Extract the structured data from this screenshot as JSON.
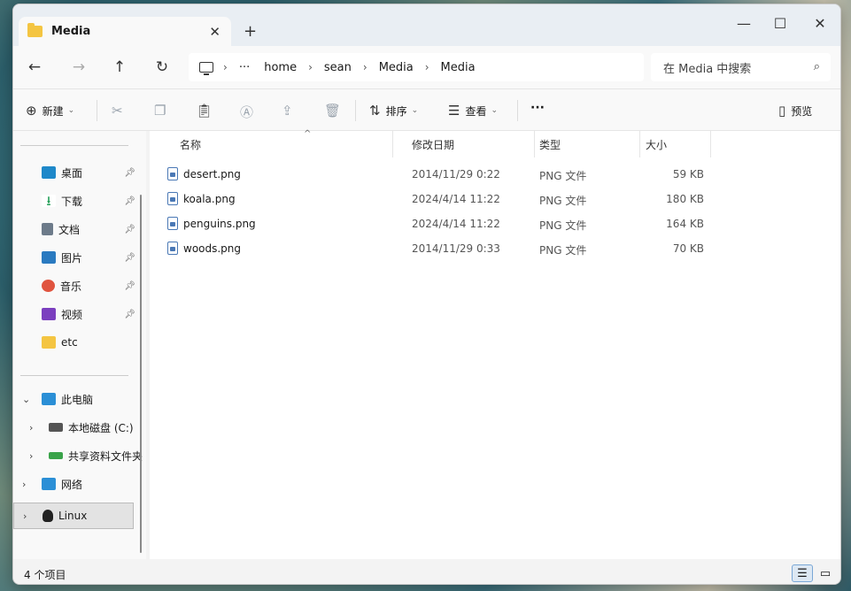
{
  "window": {
    "tab_title": "Media",
    "tab_close": "✕",
    "new_tab": "+",
    "minimize": "—",
    "maximize": "☐",
    "close": "✕"
  },
  "nav": {
    "back": "←",
    "forward": "→",
    "up": "↑",
    "refresh": "↻",
    "more": "···",
    "breadcrumb": [
      "home",
      "sean",
      "Media",
      "Media"
    ],
    "search_placeholder": "在 Media 中搜索"
  },
  "toolbar": {
    "new_label": "新建",
    "sort_label": "排序",
    "view_label": "查看",
    "more": "···",
    "preview_label": "预览"
  },
  "sidebar": {
    "quick_access": [
      {
        "label": "桌面",
        "icon": "desktop-icon",
        "color": "#1e88c9",
        "pinned": true
      },
      {
        "label": "下载",
        "icon": "download-icon",
        "color": "#1f9d55",
        "pinned": true
      },
      {
        "label": "文档",
        "icon": "documents-icon",
        "color": "#6d7b8a",
        "pinned": true
      },
      {
        "label": "图片",
        "icon": "pictures-icon",
        "color": "#2a7ac0",
        "pinned": true
      },
      {
        "label": "音乐",
        "icon": "music-icon",
        "color": "#e0543f",
        "pinned": true
      },
      {
        "label": "视频",
        "icon": "videos-icon",
        "color": "#7b3fbf",
        "pinned": true
      },
      {
        "label": "etc",
        "icon": "folder-icon",
        "color": "#f4c542",
        "pinned": false
      }
    ],
    "this_pc": "此电脑",
    "local_disk": "本地磁盘 (C:)",
    "shared_folder": "共享资料文件夹",
    "network": "网络",
    "linux": "Linux"
  },
  "columns": {
    "name": "名称",
    "modified": "修改日期",
    "type": "类型",
    "size": "大小"
  },
  "files": [
    {
      "name": "desert.png",
      "modified": "2014/11/29 0:22",
      "type": "PNG 文件",
      "size": "59 KB"
    },
    {
      "name": "koala.png",
      "modified": "2024/4/14 11:22",
      "type": "PNG 文件",
      "size": "180 KB"
    },
    {
      "name": "penguins.png",
      "modified": "2024/4/14 11:22",
      "type": "PNG 文件",
      "size": "164 KB"
    },
    {
      "name": "woods.png",
      "modified": "2014/11/29 0:33",
      "type": "PNG 文件",
      "size": "70 KB"
    }
  ],
  "status": {
    "item_count": "4 个项目"
  }
}
